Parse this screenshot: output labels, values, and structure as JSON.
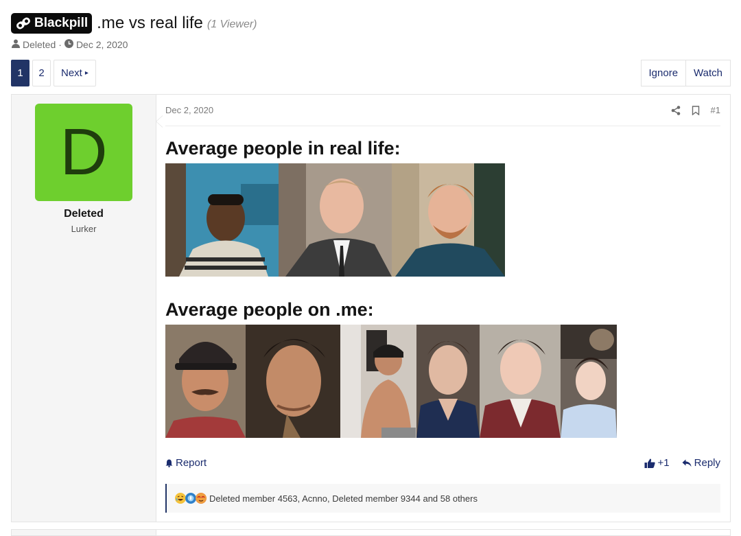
{
  "thread": {
    "prefix": "Blackpill",
    "title": ".me vs real life",
    "viewers": "(1 Viewer)",
    "author": "Deleted",
    "meta_sep": "·",
    "date": "Dec 2, 2020"
  },
  "pagination": {
    "pages": [
      "1",
      "2"
    ],
    "current": "1",
    "next_label": "Next"
  },
  "thread_actions": {
    "ignore": "Ignore",
    "watch": "Watch"
  },
  "post": {
    "user": {
      "avatar_letter": "D",
      "avatar_color": "#6ecf2e",
      "name": "Deleted",
      "title": "Lurker"
    },
    "date": "Dec 2, 2020",
    "number": "#1",
    "heading_1": "Average people in real life:",
    "heading_2": "Average people on .me:",
    "report_label": "Report",
    "like_label": "+1",
    "reply_label": "Reply",
    "reactions_text": "Deleted member 4563, Acnno, Deleted member 9344 and 58 others"
  },
  "colors": {
    "accent": "#213466",
    "link": "#1b2c6e",
    "avatar": "#6ecf2e"
  },
  "icons": [
    "user-icon",
    "clock-icon",
    "share-icon",
    "bookmark-icon",
    "bell-icon",
    "thumbs-up-icon",
    "reply-icon",
    "laugh-reaction-icon",
    "cry-reaction-icon",
    "cope-reaction-icon"
  ]
}
